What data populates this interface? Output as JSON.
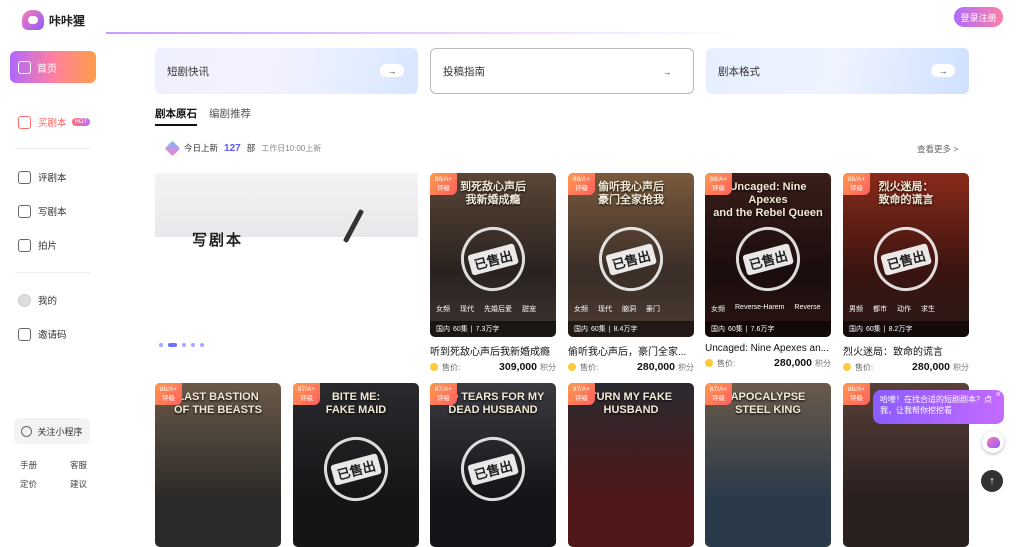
{
  "app": {
    "logo_text": "咔咔猩",
    "login_label": "登录注册"
  },
  "sidebar": {
    "home": "首页",
    "buy": "买剧本",
    "buy_badge": "HOT",
    "review": "评剧本",
    "write": "写剧本",
    "shoot": "拍片",
    "mine": "我的",
    "invite": "邀请码",
    "miniprogram": "关注小程序",
    "links": [
      "手册",
      "客服",
      "定价",
      "建议"
    ]
  },
  "banners": [
    {
      "label": "短剧快讯",
      "arrow": "→"
    },
    {
      "label": "投稿指南",
      "arrow": "→"
    },
    {
      "label": "剧本格式",
      "arrow": "→"
    }
  ],
  "tabs": [
    "剧本原石",
    "编剧推荐"
  ],
  "today": {
    "label": "今日上新",
    "count": "127",
    "unit": "部",
    "note": "工作日10:00上新"
  },
  "more": "查看更多 >",
  "carousel": {
    "text": "写剧本"
  },
  "sold_label": "已售出",
  "price_label": "售价:",
  "unit_label": "积分",
  "cards_row1": [
    {
      "rating": "88/A+",
      "rating_sub": "评级",
      "cover_title": "到死敌心声后\n我新婚成瘾",
      "genres": [
        "女频",
        "现代",
        "先婚后爱",
        "甜宠"
      ],
      "meta_region": "国内",
      "meta_eps": "60集",
      "meta_words": "7.3万字",
      "title": "听到死敌心声后我新婚成瘾",
      "price": "309,000"
    },
    {
      "rating": "88/A+",
      "rating_sub": "评级",
      "cover_title": "偷听我心声后\n豪门全家抢我",
      "genres": [
        "女频",
        "现代",
        "脑洞",
        "豪门"
      ],
      "meta_region": "国内",
      "meta_eps": "60集",
      "meta_words": "8.4万字",
      "title": "偷听我心声后，豪门全家...",
      "price": "280,000"
    },
    {
      "rating": "88/A+",
      "rating_sub": "评级",
      "cover_title": "Uncaged: Nine Apexes\nand the Rebel Queen",
      "genres": [
        "女频",
        "Reverse-Harem",
        "Reverse"
      ],
      "meta_region": "国内",
      "meta_eps": "60集",
      "meta_words": "7.6万字",
      "title": "Uncaged: Nine Apexes an...",
      "price": "280,000"
    },
    {
      "rating": "88/A+",
      "rating_sub": "评级",
      "cover_title": "烈火迷局：\n致命的谎言",
      "genres": [
        "男频",
        "都市",
        "动作",
        "求生"
      ],
      "meta_region": "国内",
      "meta_eps": "60集",
      "meta_words": "8.2万字",
      "title": "烈火迷局：致命的谎言",
      "price": "280,000"
    }
  ],
  "cards_row2": [
    {
      "rating": "88/A+",
      "rating_sub": "评级",
      "cover_title": "LAST BASTION\nOF THE BEASTS",
      "sold": false
    },
    {
      "rating": "87/A+",
      "rating_sub": "评级",
      "cover_title": "BITE ME:\nFAKE MAID",
      "sold": true
    },
    {
      "rating": "87/A+",
      "rating_sub": "评级",
      "cover_title": "NO TEARS FOR MY\nDEAD HUSBAND",
      "sold": true
    },
    {
      "rating": "87/A+",
      "rating_sub": "评级",
      "cover_title": "TURN MY FAKE\nHUSBAND",
      "sold": false
    },
    {
      "rating": "87/A+",
      "rating_sub": "评级",
      "cover_title": "APOCALYPSE\nSTEEL KING",
      "sold": false
    },
    {
      "rating": "88/A+",
      "rating_sub": "评级",
      "cover_title": "",
      "sold": false
    }
  ],
  "chat": {
    "text": "哈喽！在找合适的短剧剧本？点我，让我帮你挖挖看",
    "close": "×"
  },
  "totop": "↑",
  "colors": {
    "accent": "#b067ff",
    "accent2": "#ff7fa0",
    "rating": "#ff6f56"
  }
}
